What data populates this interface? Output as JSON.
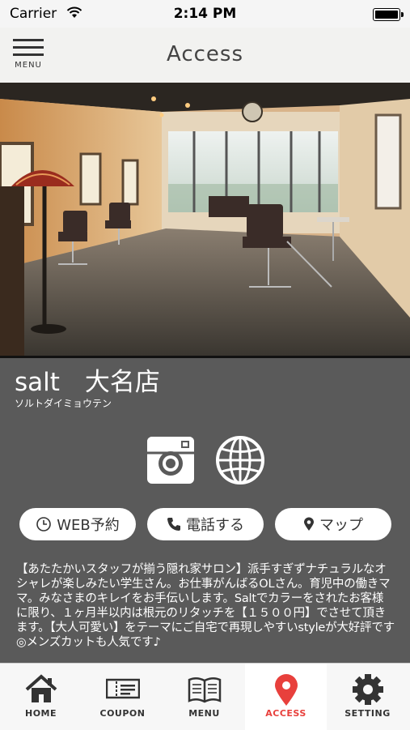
{
  "status": {
    "carrier": "Carrier",
    "time": "2:14 PM"
  },
  "header": {
    "title": "Access",
    "menu_label": "MENU"
  },
  "shop": {
    "name": "salt　大名店",
    "kana": "ソルトダイミョウテン"
  },
  "actions": {
    "web_reserve": "WEB予約",
    "call": "電話する",
    "map": "マップ"
  },
  "description": "【あたたかいスタッフが揃う隠れ家サロン】派手すぎずナチュラルなオシャレが楽しみたい学生さん。お仕事がんばるOLさん。育児中の働きママ。みなさまのキレイをお手伝いします。Saltでカラーをされたお客様に限り、１ヶ月半以内は根元のリタッチを【１５００円】でさせて頂きます。【大人可愛い】をテーマにご自宅で再現しやすいstyleが大好評です◎メンズカットも人気です♪",
  "tabs": [
    {
      "label": "HOME",
      "icon": "home-icon"
    },
    {
      "label": "COUPON",
      "icon": "ticket-icon"
    },
    {
      "label": "MENU",
      "icon": "book-icon"
    },
    {
      "label": "ACCESS",
      "icon": "map-pin-icon",
      "active": true
    },
    {
      "label": "SETTING",
      "icon": "gear-icon"
    }
  ],
  "colors": {
    "accent": "#e8403c",
    "panel": "#5a5a5a",
    "nav_bg": "#f2f2f0"
  }
}
